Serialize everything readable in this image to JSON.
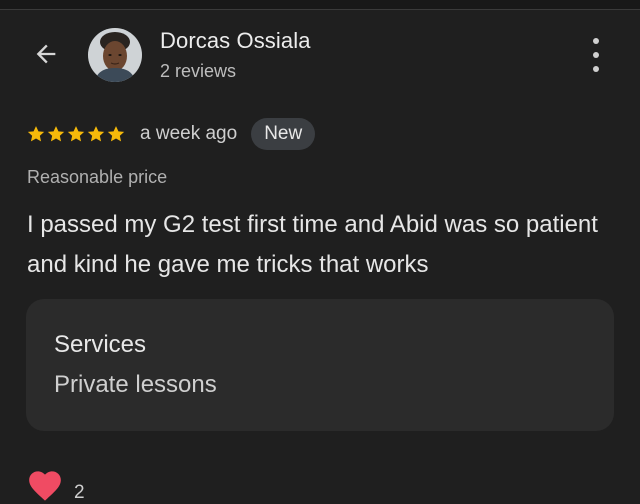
{
  "reviewer": {
    "name": "Dorcas Ossiala",
    "review_count": "2 reviews"
  },
  "review": {
    "rating": 5,
    "rating_max": 5,
    "time": "a week ago",
    "badge": "New",
    "attribute": "Reasonable price",
    "text": "I passed my G2 test first time and Abid was so patient and kind he gave me tricks that works",
    "services_label": "Services",
    "services_value": "Private lessons"
  },
  "reactions": {
    "icon": "heart-icon",
    "count": "2"
  },
  "icons": {
    "back": "arrow-left-icon",
    "more": "more-vert-icon",
    "star": "star-icon"
  },
  "colors": {
    "background": "#1f1f1f",
    "star": "#f6b90a",
    "heart": "#f04b63",
    "badge_bg": "#3b3e42",
    "card_bg": "#2b2b2b"
  }
}
